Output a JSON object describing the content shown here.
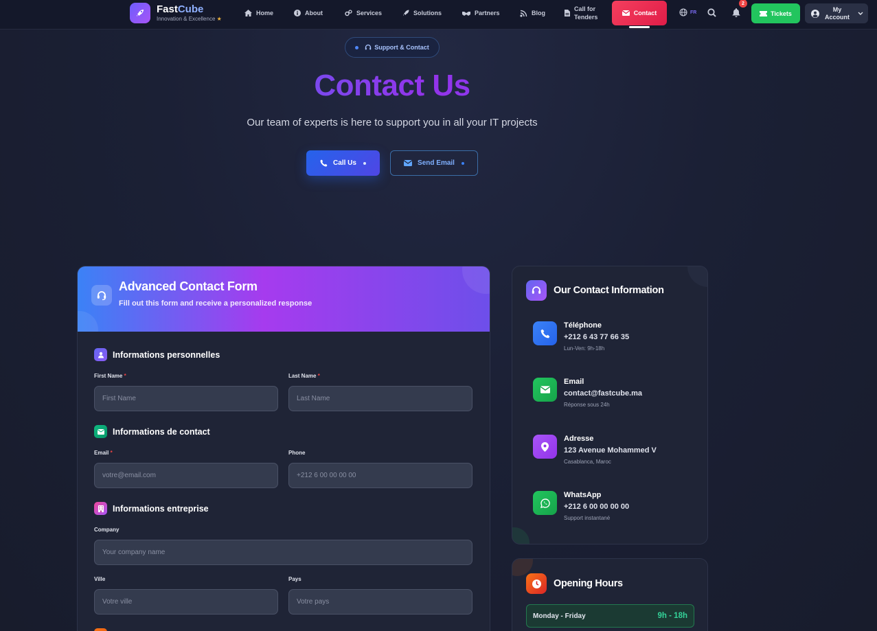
{
  "brand": {
    "name_part1": "Fast",
    "name_part2": "Cube",
    "tagline": "Innovation & Excellence",
    "tagline_icon": "star-icon"
  },
  "nav": {
    "items": [
      {
        "label": "Home",
        "icon": "home-icon"
      },
      {
        "label": "About",
        "icon": "info-icon"
      },
      {
        "label": "Services",
        "icon": "cogs-icon"
      },
      {
        "label": "Solutions",
        "icon": "rocket-icon"
      },
      {
        "label": "Partners",
        "icon": "handshake-icon"
      },
      {
        "label": "Blog",
        "icon": "blog-icon"
      },
      {
        "label_line1": "Call for",
        "label_line2": "Tenders",
        "icon": "file-icon"
      }
    ],
    "contact_label": "Contact",
    "language": "FR",
    "notification_count": "2",
    "tickets_label": "Tickets",
    "account_line1": "My",
    "account_line2": "Account"
  },
  "hero": {
    "badge": "Support & Contact",
    "title": "Contact Us",
    "subtitle": "Our team of experts is here to support you in all your IT projects",
    "call_button": "Call Us",
    "email_button": "Send Email"
  },
  "form": {
    "title": "Advanced Contact Form",
    "subtitle": "Fill out this form and receive a personalized response",
    "sections": {
      "personal": "Informations personnelles",
      "contact": "Informations de contact",
      "company": "Informations entreprise"
    },
    "fields": {
      "first_name": {
        "label": "First Name",
        "required": "*",
        "placeholder": "First Name",
        "value": ""
      },
      "last_name": {
        "label": "Last Name",
        "required": "*",
        "placeholder": "Last Name",
        "value": ""
      },
      "email": {
        "label": "Email",
        "required": "*",
        "placeholder": "votre@email.com",
        "value": ""
      },
      "phone": {
        "label": "Phone",
        "placeholder": "+212 6 00 00 00 00",
        "value": ""
      },
      "company": {
        "label": "Company",
        "placeholder": "Your company name",
        "value": ""
      },
      "city": {
        "label": "Ville",
        "placeholder": "Votre ville",
        "value": ""
      },
      "country": {
        "label": "Pays",
        "placeholder": "Votre pays",
        "value": ""
      }
    }
  },
  "contact_info": {
    "title": "Our Contact Information",
    "items": [
      {
        "label": "Téléphone",
        "value": "+212 6 43 77 66 35",
        "note": "Lun-Ven: 9h-18h",
        "icon": "phone-icon",
        "color": "#3b82f6"
      },
      {
        "label": "Email",
        "value": "contact@fastcube.ma",
        "note": "Réponse sous 24h",
        "icon": "envelope-icon",
        "color": "#22c55e"
      },
      {
        "label": "Adresse",
        "value": "123 Avenue Mohammed V",
        "note": "Casablanca, Maroc",
        "icon": "map-pin-icon",
        "color": "#a855f7"
      },
      {
        "label": "WhatsApp",
        "value": "+212 6 00 00 00 00",
        "note": "Support instantané",
        "icon": "whatsapp-icon",
        "color": "#22c55e"
      }
    ]
  },
  "hours": {
    "title": "Opening Hours",
    "rows": [
      {
        "day": "Monday - Friday",
        "time": "9h - 18h"
      }
    ]
  },
  "colors": {
    "accent_blue": "#3b82f6",
    "accent_purple": "#a855f7",
    "contact_red": "#e11d48",
    "tickets_green": "#22c55e",
    "background": "#1b2035"
  }
}
